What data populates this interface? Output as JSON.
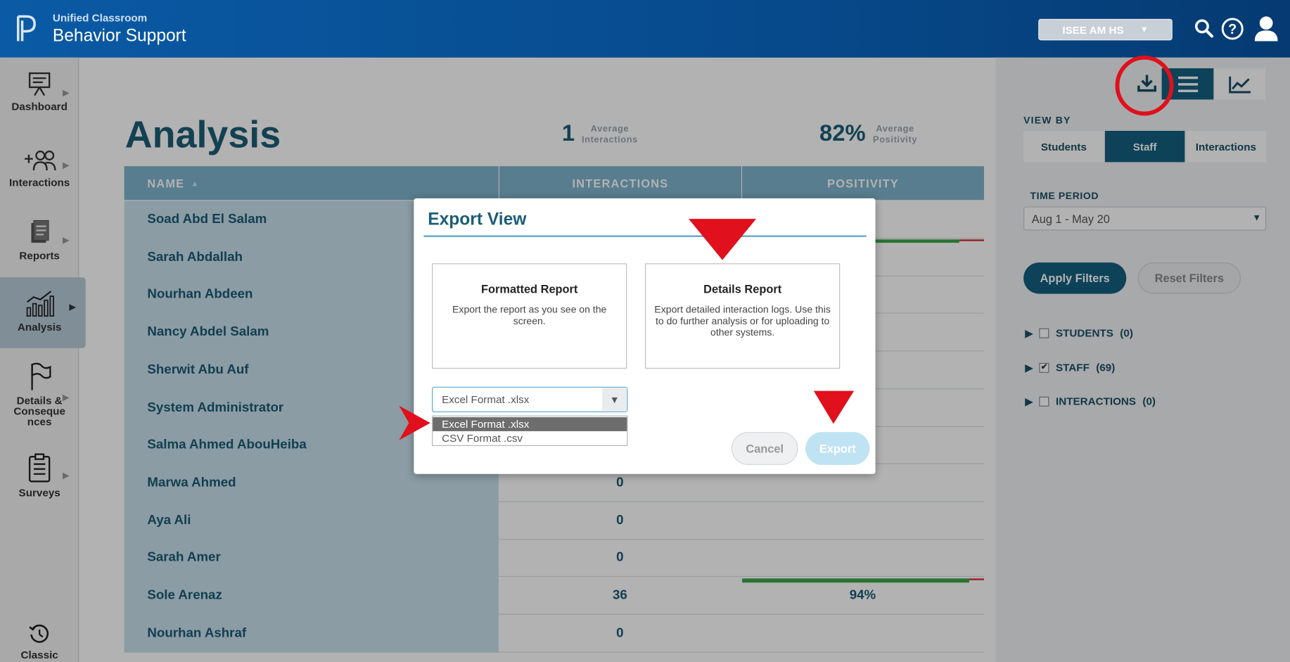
{
  "header": {
    "app_subtitle": "Unified Classroom",
    "app_title": "Behavior Support",
    "school_select": "ISEE AM HS"
  },
  "nav": {
    "items": [
      {
        "label": "Dashboard"
      },
      {
        "label": "Interactions"
      },
      {
        "label": "Reports"
      },
      {
        "label": "Analysis"
      },
      {
        "label": "Details &\nConseque\nnces"
      },
      {
        "label": "Surveys"
      },
      {
        "label": "Classic"
      }
    ],
    "active": "Analysis"
  },
  "page": {
    "title": "Analysis",
    "stats": [
      {
        "value": "1",
        "label": "Average\nInteractions"
      },
      {
        "value": "82%",
        "label": "Average\nPositivity"
      }
    ]
  },
  "table": {
    "columns": [
      "NAME",
      "INTERACTIONS",
      "POSITIVITY"
    ],
    "rows": [
      {
        "name": "Soad Abd El Salam",
        "interactions": "",
        "positivity": ""
      },
      {
        "name": "Sarah Abdallah",
        "interactions": "",
        "positivity": ""
      },
      {
        "name": "Nourhan Abdeen",
        "interactions": "",
        "positivity": ""
      },
      {
        "name": "Nancy Abdel Salam",
        "interactions": "",
        "positivity": ""
      },
      {
        "name": "Sherwit Abu Auf",
        "interactions": "",
        "positivity": ""
      },
      {
        "name": "System Administrator",
        "interactions": "",
        "positivity": ""
      },
      {
        "name": "Salma Ahmed AbouHeiba",
        "interactions": "",
        "positivity": ""
      },
      {
        "name": "Marwa Ahmed",
        "interactions": "0",
        "positivity": ""
      },
      {
        "name": "Aya Ali",
        "interactions": "0",
        "positivity": ""
      },
      {
        "name": "Sarah Amer",
        "interactions": "0",
        "positivity": ""
      },
      {
        "name": "Sole Arenaz",
        "interactions": "36",
        "positivity": "94%"
      },
      {
        "name": "Nourhan Ashraf",
        "interactions": "0",
        "positivity": ""
      }
    ]
  },
  "right_panel": {
    "view_by_label": "VIEW BY",
    "view_by_options": [
      "Students",
      "Staff",
      "Interactions"
    ],
    "view_by_selected": "Staff",
    "time_period_label": "TIME PERIOD",
    "time_period_value": "Aug 1 - May 20",
    "apply_label": "Apply Filters",
    "reset_label": "Reset Filters",
    "filters": [
      {
        "label": "STUDENTS",
        "count": "(0)",
        "checked": false
      },
      {
        "label": "STAFF",
        "count": "(69)",
        "checked": true
      },
      {
        "label": "INTERACTIONS",
        "count": "(0)",
        "checked": false
      }
    ]
  },
  "modal": {
    "title": "Export View",
    "cards": [
      {
        "title": "Formatted Report",
        "desc": "Export the report as you see on the screen."
      },
      {
        "title": "Details Report",
        "desc": "Export detailed interaction logs. Use this to do further analysis or for uploading to other systems."
      }
    ],
    "format_selected": "Excel Format .xlsx",
    "format_options": [
      "Excel Format .xlsx",
      "CSV Format .csv"
    ],
    "cancel_label": "Cancel",
    "export_label": "Export"
  },
  "colors": {
    "header": "#0a5aa5",
    "primary": "#1c5d76",
    "accent": "#135f80",
    "annotation_red": "#e0101c",
    "positive_bar": "#3aa548"
  }
}
